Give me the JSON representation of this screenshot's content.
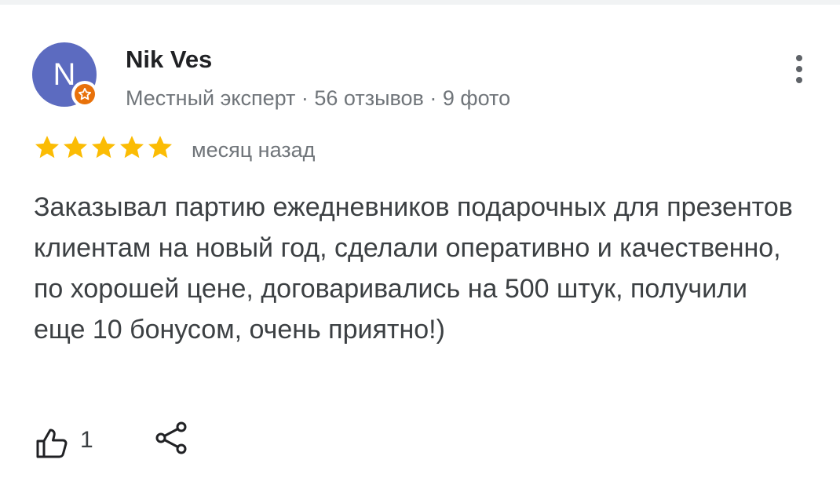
{
  "review": {
    "author": {
      "name": "Nik Ves",
      "avatar_letter": "N",
      "meta": "Местный эксперт · 56 отзывов · 9 фото",
      "avatar_color": "#5c6bc0",
      "badge_color": "#e8710a"
    },
    "rating": 5,
    "rating_max": 5,
    "star_color": "#fbbc04",
    "date": "месяц назад",
    "text": "Заказывал партию ежедневников подарочных для презентов клиентам на новый год, сделали оперативно и качественно, по хорошей цене, договаривались на 500 штук, получили еще 10 бонусом, очень приятно!)",
    "likes": "1"
  },
  "icons": {
    "more": "more-vert-icon",
    "like": "thumb-up-icon",
    "share": "share-icon",
    "badge": "local-guide-star-icon",
    "star": "star-icon"
  }
}
